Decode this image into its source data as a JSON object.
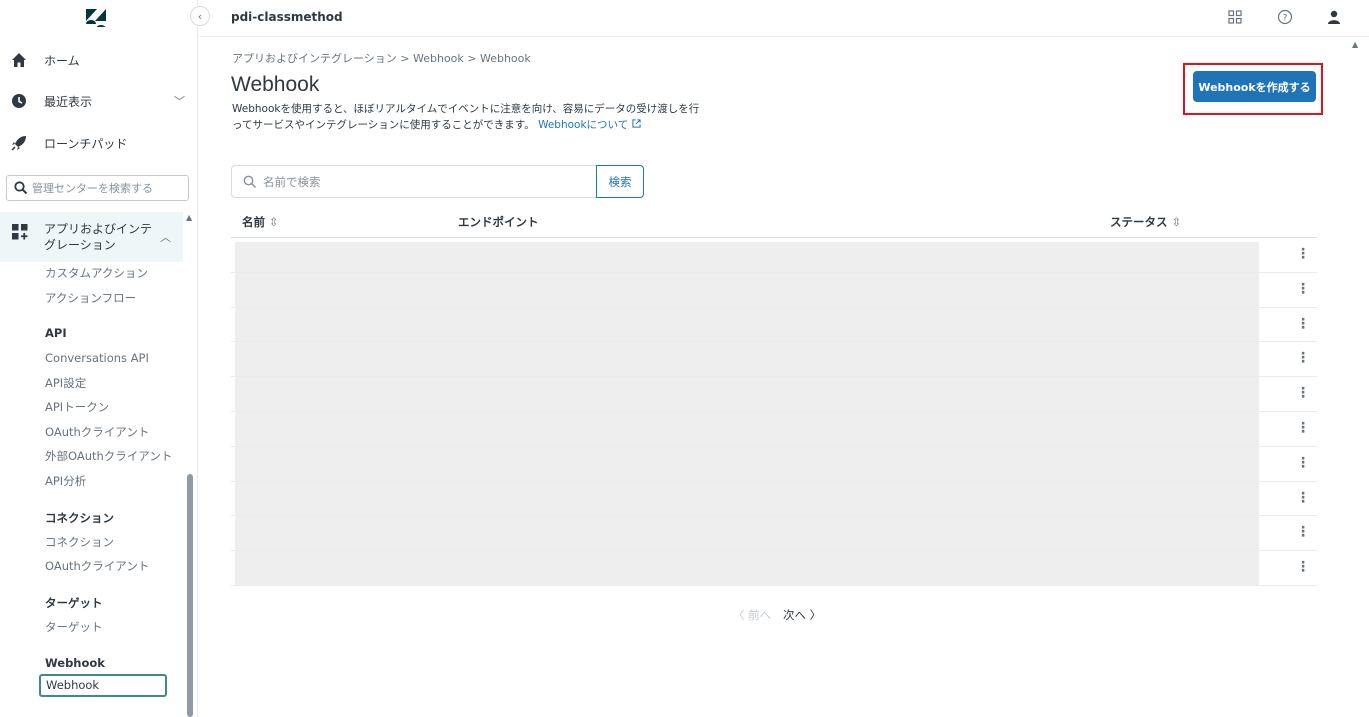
{
  "app": {
    "account_name": "pdi-classmethod",
    "brand_color": "#1f73b7",
    "highlight_color": "#e0141e"
  },
  "sidebar": {
    "collapse_icon": "chevron-left-icon",
    "nav": [
      {
        "icon": "home-icon",
        "label": "ホーム"
      },
      {
        "icon": "clock-icon",
        "label": "最近表示"
      },
      {
        "icon": "rocket-icon",
        "label": "ローンチパッド"
      }
    ],
    "search_placeholder": "管理センターを検索する",
    "active_group": {
      "icon": "apps-integrations-icon",
      "label": "アプリおよびインテグレーション"
    },
    "items_top": [
      "カスタムアクション",
      "アクションフロー"
    ],
    "sections": [
      {
        "heading": "API",
        "items": [
          "Conversations API",
          "API設定",
          "APIトークン",
          "OAuthクライアント",
          "外部OAuthクライアント",
          "API分析"
        ]
      },
      {
        "heading": "コネクション",
        "items": [
          "コネクション",
          "OAuthクライアント"
        ]
      },
      {
        "heading": "ターゲット",
        "items": [
          "ターゲット"
        ]
      },
      {
        "heading": "Webhook",
        "items": []
      }
    ],
    "selected_item": "Webhook"
  },
  "topbar": {
    "icons": [
      "products-grid-icon",
      "help-icon",
      "user-icon"
    ]
  },
  "main": {
    "breadcrumb": "アプリおよびインテグレーション > Webhook > Webhook",
    "title": "Webhook",
    "description": "Webhookを使用すると、ほぼリアルタイムでイベントに注意を向け、容易にデータの受け渡しを行ってサービスやインテグレーションに使用することができます。",
    "description_link": "Webhookについて",
    "create_button": "Webhookを作成する",
    "search_placeholder": "名前で検索",
    "search_button": "検索",
    "columns": {
      "name": "名前",
      "endpoint": "エンドポイント",
      "status": "ステータス"
    },
    "row_count": 10,
    "pager": {
      "prev": "〈 前へ",
      "next": "次へ 〉"
    }
  }
}
